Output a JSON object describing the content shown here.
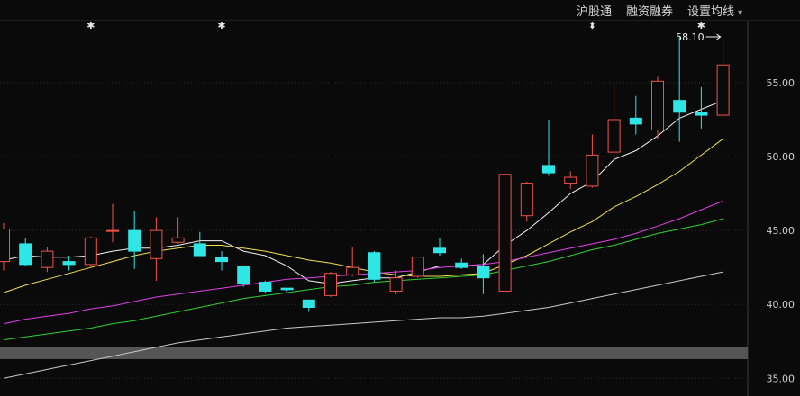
{
  "toolbar": {
    "hgt_label": "沪股通",
    "margin_label": "融资融券",
    "ma_setting_label": "设置均线",
    "ma_dropdown_glyph": "▾"
  },
  "price_annotation": "58.10",
  "colors": {
    "background": "#0a0a0a",
    "up": "#f0534a",
    "down": "#2fe6e6",
    "ma5": "#f2f2f2",
    "ma10": "#f0e050",
    "ma20": "#e040e8",
    "ma30": "#30d030",
    "ma60": "#c8c8c8",
    "grid": "#2e2e2e",
    "axis_text": "#cfcfcf",
    "band": "#555555"
  },
  "chart_data": {
    "type": "candlestick",
    "title": "",
    "xlabel": "",
    "ylabel": "",
    "ylim": [
      33.8,
      59.2
    ],
    "yticks": [
      "55.00",
      "50.00",
      "45.00",
      "40.00",
      "35.00"
    ],
    "ytick_values": [
      55,
      50,
      45,
      40,
      35
    ],
    "grid": "horizontal dotted",
    "candles": [
      {
        "open": 42.9,
        "close": 45.1,
        "high": 45.5,
        "low": 42.3
      },
      {
        "open": 44.1,
        "close": 42.7,
        "high": 44.5,
        "low": 42.6
      },
      {
        "open": 42.5,
        "close": 43.6,
        "high": 43.9,
        "low": 42.2
      },
      {
        "open": 42.9,
        "close": 42.7,
        "high": 43.3,
        "low": 42.3
      },
      {
        "open": 42.7,
        "close": 44.5,
        "high": 44.6,
        "low": 42.5
      },
      {
        "open": 45.0,
        "close": 45.0,
        "high": 46.8,
        "low": 44.2
      },
      {
        "open": 45.0,
        "close": 43.6,
        "high": 46.3,
        "low": 42.4
      },
      {
        "open": 43.1,
        "close": 45.0,
        "high": 45.9,
        "low": 41.6
      },
      {
        "open": 44.2,
        "close": 44.5,
        "high": 45.9,
        "low": 44.1
      },
      {
        "open": 44.1,
        "close": 43.3,
        "high": 44.9,
        "low": 43.3
      },
      {
        "open": 43.2,
        "close": 42.9,
        "high": 43.6,
        "low": 42.3
      },
      {
        "open": 42.6,
        "close": 41.4,
        "high": 42.6,
        "low": 41.2
      },
      {
        "open": 41.5,
        "close": 40.9,
        "high": 41.6,
        "low": 40.8
      },
      {
        "open": 41.1,
        "close": 41.0,
        "high": 41.1,
        "low": 40.9
      },
      {
        "open": 40.3,
        "close": 39.8,
        "high": 40.3,
        "low": 39.5
      },
      {
        "open": 40.6,
        "close": 42.1,
        "high": 42.2,
        "low": 40.5
      },
      {
        "open": 42.0,
        "close": 42.5,
        "high": 43.9,
        "low": 41.9
      },
      {
        "open": 43.5,
        "close": 41.7,
        "high": 43.6,
        "low": 41.5
      },
      {
        "open": 40.9,
        "close": 41.8,
        "high": 42.3,
        "low": 40.7
      },
      {
        "open": 41.9,
        "close": 43.2,
        "high": 43.2,
        "low": 41.8
      },
      {
        "open": 43.8,
        "close": 43.5,
        "high": 44.5,
        "low": 43.3
      },
      {
        "open": 42.8,
        "close": 42.5,
        "high": 43.1,
        "low": 42.4
      },
      {
        "open": 42.6,
        "close": 41.8,
        "high": 43.4,
        "low": 40.7
      },
      {
        "open": 40.9,
        "close": 48.8,
        "high": 48.8,
        "low": 40.8
      },
      {
        "open": 46.0,
        "close": 48.2,
        "high": 48.3,
        "low": 45.6
      },
      {
        "open": 49.4,
        "close": 48.9,
        "high": 52.5,
        "low": 48.7
      },
      {
        "open": 48.2,
        "close": 48.6,
        "high": 49.0,
        "low": 47.8
      },
      {
        "open": 48.0,
        "close": 50.1,
        "high": 51.5,
        "low": 47.9
      },
      {
        "open": 50.3,
        "close": 52.5,
        "high": 54.8,
        "low": 50.0
      },
      {
        "open": 52.6,
        "close": 52.2,
        "high": 54.1,
        "low": 51.5
      },
      {
        "open": 51.8,
        "close": 55.1,
        "high": 55.4,
        "low": 51.2
      },
      {
        "open": 53.8,
        "close": 53.0,
        "high": 58.1,
        "low": 51.0
      },
      {
        "open": 53.0,
        "close": 52.8,
        "high": 54.7,
        "low": 51.9
      },
      {
        "open": 52.8,
        "close": 56.2,
        "high": 58.0,
        "low": 52.7
      }
    ],
    "ma_lines": [
      {
        "color_key": "ma5",
        "values": [
          43.0,
          43.3,
          43.2,
          43.2,
          43.3,
          43.6,
          43.8,
          43.8,
          44.0,
          44.3,
          44.3,
          43.6,
          43.3,
          42.6,
          41.6,
          41.4,
          41.6,
          41.8,
          41.8,
          42.2,
          42.6,
          42.6,
          42.7,
          44.0,
          45.0,
          46.2,
          47.5,
          48.3,
          49.8,
          50.4,
          51.4,
          52.6,
          53.2,
          53.8
        ]
      },
      {
        "color_key": "ma10",
        "values": [
          40.8,
          41.3,
          41.7,
          42.1,
          42.5,
          42.9,
          43.3,
          43.6,
          43.8,
          44.0,
          44.0,
          43.8,
          43.6,
          43.3,
          43.0,
          42.8,
          42.5,
          42.2,
          42.0,
          41.9,
          41.9,
          42.0,
          42.1,
          42.7,
          43.3,
          44.1,
          44.9,
          45.6,
          46.6,
          47.3,
          48.1,
          49.0,
          50.1,
          51.2
        ]
      },
      {
        "color_key": "ma20",
        "values": [
          38.7,
          39.0,
          39.2,
          39.4,
          39.7,
          39.9,
          40.2,
          40.5,
          40.7,
          40.9,
          41.1,
          41.3,
          41.5,
          41.7,
          41.8,
          41.9,
          42.0,
          42.1,
          42.2,
          42.3,
          42.5,
          42.6,
          42.7,
          42.9,
          43.2,
          43.5,
          43.8,
          44.1,
          44.4,
          44.8,
          45.3,
          45.8,
          46.4,
          47.0
        ]
      },
      {
        "color_key": "ma30",
        "values": [
          37.6,
          37.8,
          38.0,
          38.2,
          38.4,
          38.7,
          38.9,
          39.2,
          39.5,
          39.8,
          40.1,
          40.4,
          40.6,
          40.8,
          41.0,
          41.2,
          41.3,
          41.5,
          41.6,
          41.7,
          41.8,
          41.9,
          42.0,
          42.3,
          42.6,
          42.9,
          43.3,
          43.7,
          44.0,
          44.4,
          44.8,
          45.1,
          45.4,
          45.8
        ]
      },
      {
        "color_key": "ma60",
        "values": [
          35.0,
          35.3,
          35.6,
          35.9,
          36.2,
          36.5,
          36.8,
          37.1,
          37.4,
          37.6,
          37.8,
          38.0,
          38.2,
          38.4,
          38.5,
          38.6,
          38.7,
          38.8,
          38.9,
          39.0,
          39.1,
          39.1,
          39.2,
          39.4,
          39.6,
          39.8,
          40.1,
          40.4,
          40.7,
          41.0,
          41.3,
          41.6,
          41.9,
          42.2
        ]
      }
    ],
    "markers": [
      {
        "index": 4,
        "symbol": "✱"
      },
      {
        "index": 10,
        "symbol": "✱"
      },
      {
        "index": 27,
        "symbol": "⬍"
      },
      {
        "index": 32,
        "symbol": "✱"
      }
    ],
    "annotation": {
      "index": 33,
      "value": 58.1
    },
    "band": {
      "from": 36.3,
      "to": 37.1
    }
  }
}
